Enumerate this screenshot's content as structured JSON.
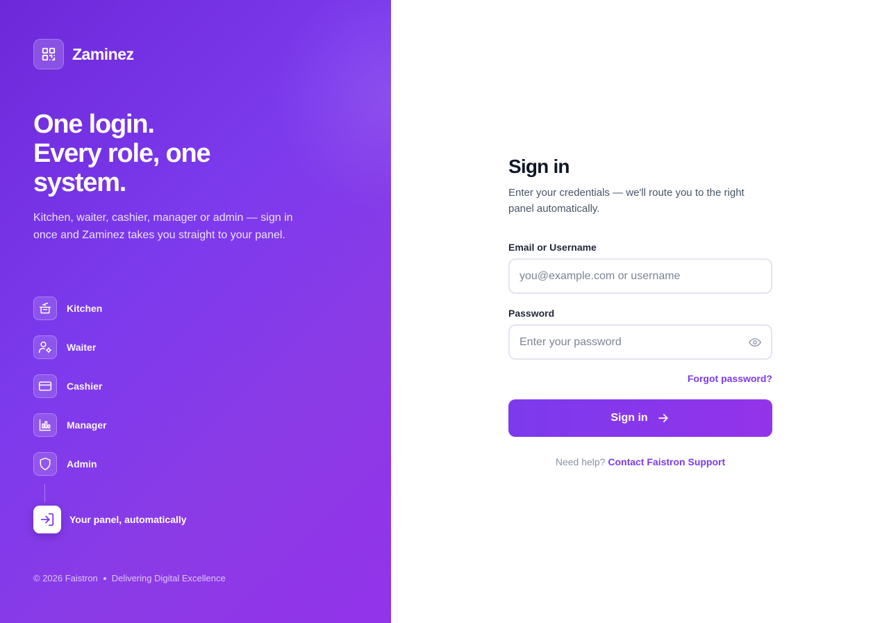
{
  "brand": {
    "name": "Zaminez",
    "logo_icon": "qr-code-icon"
  },
  "hero": {
    "headline_line1": "One login.",
    "headline_line2": "Every role, one",
    "headline_line3": "system.",
    "subcopy": "Kitchen, waiter, cashier, manager or admin — sign in once and Zaminez takes you straight to your panel."
  },
  "roles": [
    {
      "label": "Kitchen",
      "icon": "cooking-pot-icon"
    },
    {
      "label": "Waiter",
      "icon": "user-gear-icon"
    },
    {
      "label": "Cashier",
      "icon": "credit-card-icon"
    },
    {
      "label": "Manager",
      "icon": "bar-chart-icon"
    },
    {
      "label": "Admin",
      "icon": "shield-icon"
    }
  ],
  "final_step": {
    "label": "Your panel, automatically",
    "icon": "login-arrow-icon"
  },
  "footer": {
    "copyright": "© 2026 Faistron",
    "tagline": "Delivering Digital Excellence"
  },
  "form": {
    "title": "Sign in",
    "description": "Enter your credentials — we'll route you to the right panel automatically.",
    "email_label": "Email or Username",
    "email_placeholder": "you@example.com or username",
    "password_label": "Password",
    "password_placeholder": "Enter your password",
    "forgot_link": "Forgot password?",
    "submit_label": "Sign in",
    "help_text": "Need help?",
    "help_link": "Contact Faistron Support"
  },
  "colors": {
    "accent": "#7c3aed",
    "accent_end": "#9333ea",
    "heading": "#0f172a"
  }
}
